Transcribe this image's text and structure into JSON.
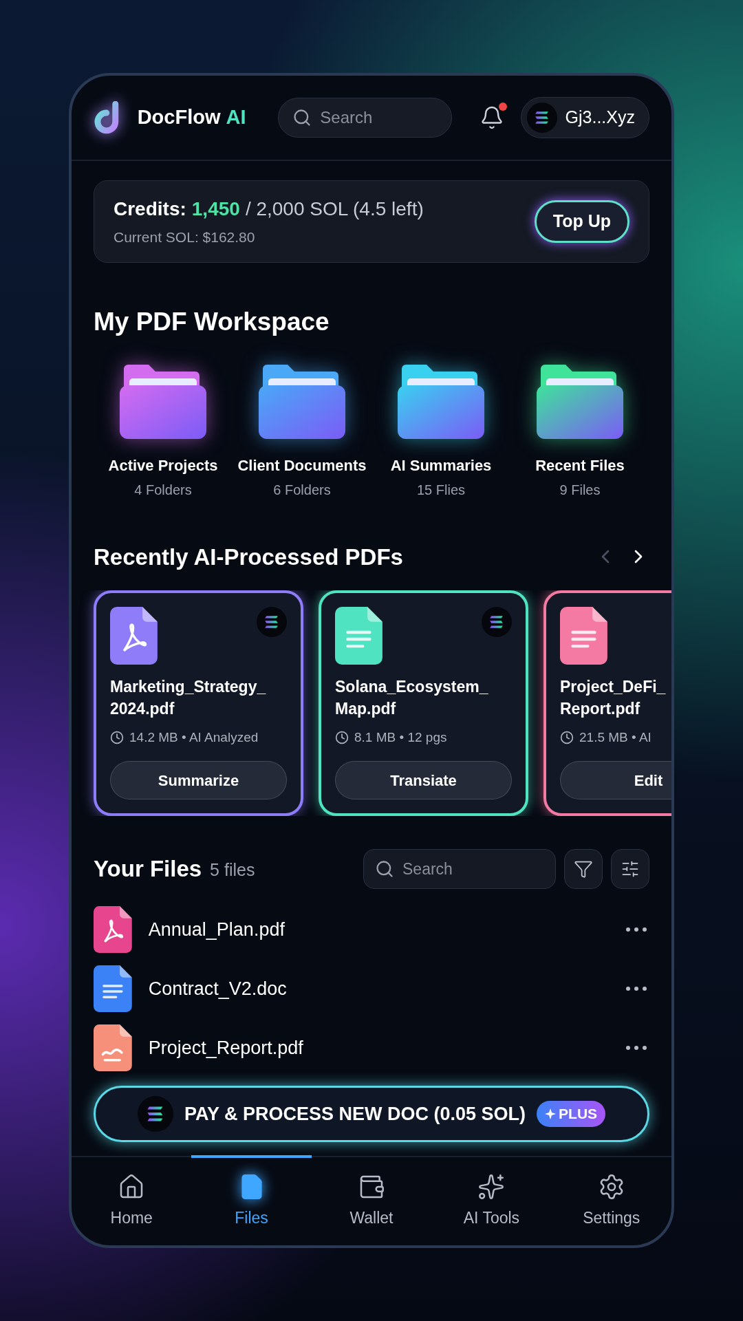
{
  "header": {
    "brand": "DocFlow",
    "brand_accent": "AI",
    "search": {
      "placeholder": "Search"
    },
    "notifications": {
      "unread": true
    },
    "wallet": "Gj3...Xyz"
  },
  "credits": {
    "label": "Credits:",
    "used": "1,450",
    "total": "/ 2,000 SOL (4.5 left)",
    "sub": "Current SOL: $162.80",
    "button": "Top Up"
  },
  "workspace": {
    "title": "My PDF Workspace",
    "folders": [
      {
        "name": "Active Projects",
        "count": "4 Folders",
        "color": "#d46cf0"
      },
      {
        "name": "Client Documents",
        "count": "6 Folders",
        "color": "#4aa8f7"
      },
      {
        "name": "AI Summaries",
        "count": "15 Flies",
        "color": "#3ad0f0"
      },
      {
        "name": "Recent Files",
        "count": "9 Files",
        "color": "#3fe39a"
      }
    ]
  },
  "recent": {
    "title": "Recently AI-Processed PDFs",
    "prev": {
      "disabled": true
    },
    "next": {
      "disabled": false
    },
    "cards": [
      {
        "name": "Marketing_Strategy_",
        "name_2": "2024.pdf",
        "meta": "14.2 MB • AI Analyzed",
        "action": "Summarize",
        "color": "#8f7cf8",
        "kind": "pdf"
      },
      {
        "name": "Solana_Ecosystem_",
        "name_2": "Map.pdf",
        "meta": "8.1 MB • 12 pgs",
        "action": "Transiate",
        "color": "#4fe3c1",
        "kind": "doc"
      },
      {
        "name": "Project_DeFi_",
        "name_2": "Report.pdf",
        "meta": "21.5 MB • AI",
        "action": "Edit",
        "color": "#f47aa3",
        "kind": "doc"
      }
    ]
  },
  "files": {
    "title": "Your Files",
    "count": "5 files",
    "search": {
      "placeholder": "Search"
    },
    "items": [
      {
        "name": "Annual_Plan.pdf",
        "kind": "pdf",
        "color": "#e8458f"
      },
      {
        "name": "Contract_V2.doc",
        "kind": "doc",
        "color": "#3b82f6"
      },
      {
        "name": "Project_Report.pdf",
        "kind": "chart",
        "color": "#f6907a"
      }
    ]
  },
  "pay": {
    "label": "PAY & PROCESS NEW DOC (0.05 SOL)",
    "badge": "PLUS"
  },
  "nav": [
    {
      "label": "Home",
      "kind": "home",
      "selected": false
    },
    {
      "label": "Files",
      "kind": "files",
      "selected": true
    },
    {
      "label": "Wallet",
      "kind": "wallet",
      "selected": false
    },
    {
      "label": "AI Tools",
      "kind": "ai",
      "selected": false
    },
    {
      "label": "Settings",
      "kind": "settings",
      "selected": false
    }
  ]
}
